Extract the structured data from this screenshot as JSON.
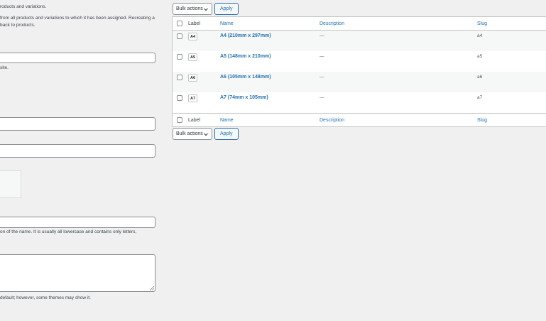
{
  "left_panel": {
    "text_line_1": "roducts and variations.",
    "text_line_2": "from all products and variations to which it has been assigned. Recreating a",
    "text_line_3": "back to products.",
    "text_line_4": "site.",
    "slug_help": "on of the name. It is usually all lowercase and contains only letters,",
    "description_help": " default; however, some themes may show it."
  },
  "bulk_top": {
    "bulk_label": "Bulk actions",
    "apply_label": "Apply"
  },
  "bulk_bottom": {
    "bulk_label": "Bulk actions",
    "apply_label": "Apply"
  },
  "table": {
    "headers": {
      "label": "Label",
      "name": "Name",
      "description": "Description",
      "slug": "Slug"
    },
    "rows": [
      {
        "badge": "A4",
        "name": "A4 (210mm x 297mm)",
        "description": "—",
        "slug": "a4"
      },
      {
        "badge": "A5",
        "name": "A5 (148mm x 210mm)",
        "description": "—",
        "slug": "a5"
      },
      {
        "badge": "A6",
        "name": "A6 (105mm x 148mm)",
        "description": "—",
        "slug": "a6"
      },
      {
        "badge": "A7",
        "name": "A7 (74mm x 105mm)",
        "description": "—",
        "slug": "a7"
      }
    ]
  }
}
